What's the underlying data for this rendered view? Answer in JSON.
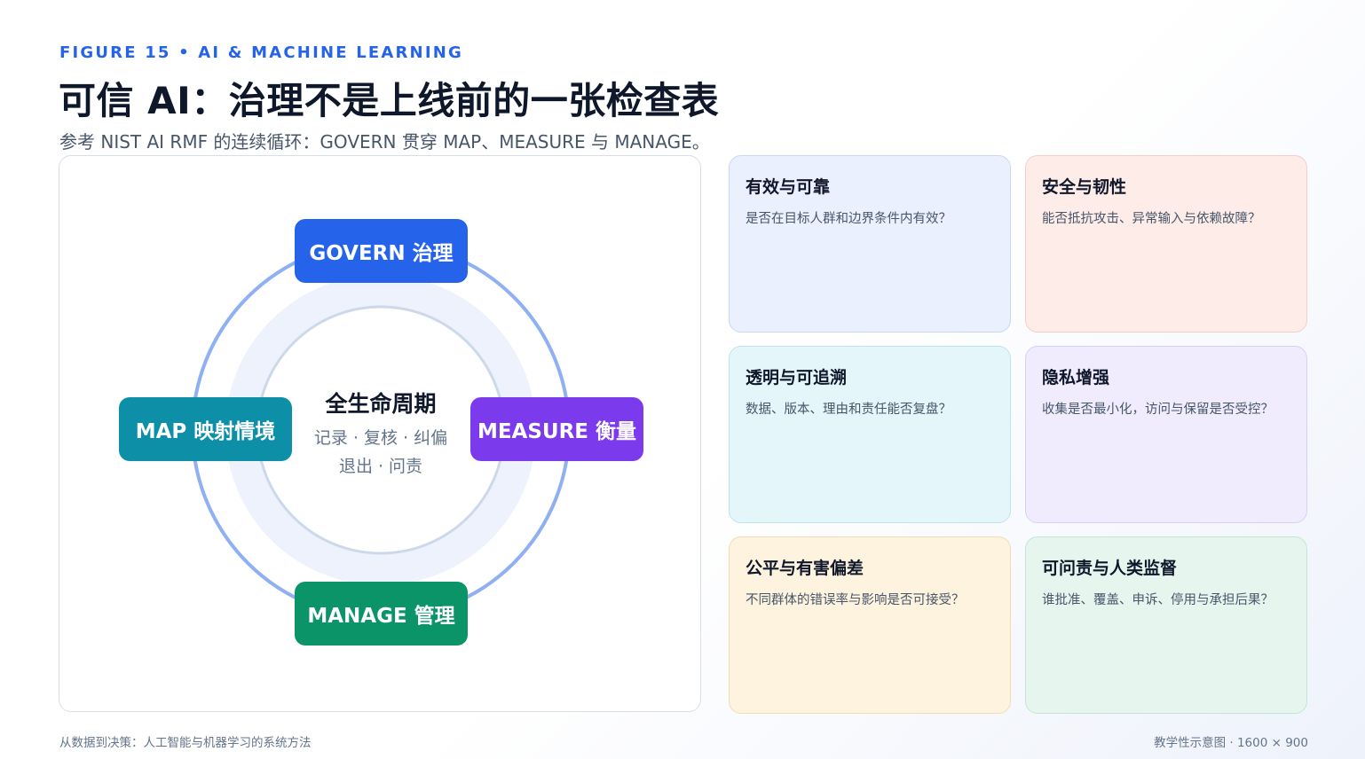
{
  "header": {
    "eyebrow": "FIGURE 15 • AI & MACHINE LEARNING",
    "title": "可信 AI：治理不是上线前的一张检查表",
    "subtitle": "参考 NIST AI RMF 的连续循环：GOVERN 贯穿 MAP、MEASURE 与 MANAGE。"
  },
  "cycle": {
    "nodes": {
      "govern": "GOVERN 治理",
      "map": "MAP 映射情境",
      "measure": "MEASURE 衡量",
      "manage": "MANAGE 管理"
    },
    "center": {
      "title": "全生命周期",
      "line1": "记录 · 复核 · 纠偏",
      "line2": "退出 · 问责"
    }
  },
  "cards": [
    {
      "title": "有效与可靠",
      "question": "是否在目标人群和边界条件内有效？"
    },
    {
      "title": "安全与韧性",
      "question": "能否抵抗攻击、异常输入与依赖故障？"
    },
    {
      "title": "透明与可追溯",
      "question": "数据、版本、理由和责任能否复盘？"
    },
    {
      "title": "隐私增强",
      "question": "收集是否最小化，访问与保留是否受控？"
    },
    {
      "title": "公平与有害偏差",
      "question": "不同群体的错误率与影响是否可接受？"
    },
    {
      "title": "可问责与人类监督",
      "question": "谁批准、覆盖、申诉、停用与承担后果？"
    }
  ],
  "footer": {
    "left": "从数据到决策：人工智能与机器学习的系统方法",
    "right": "教学性示意图 · 1600 × 900"
  },
  "colors": {
    "govern": "#2563eb",
    "map": "#0e8fa8",
    "measure": "#7c3aed",
    "manage": "#0b9467",
    "ring": "#8fb0f3"
  }
}
